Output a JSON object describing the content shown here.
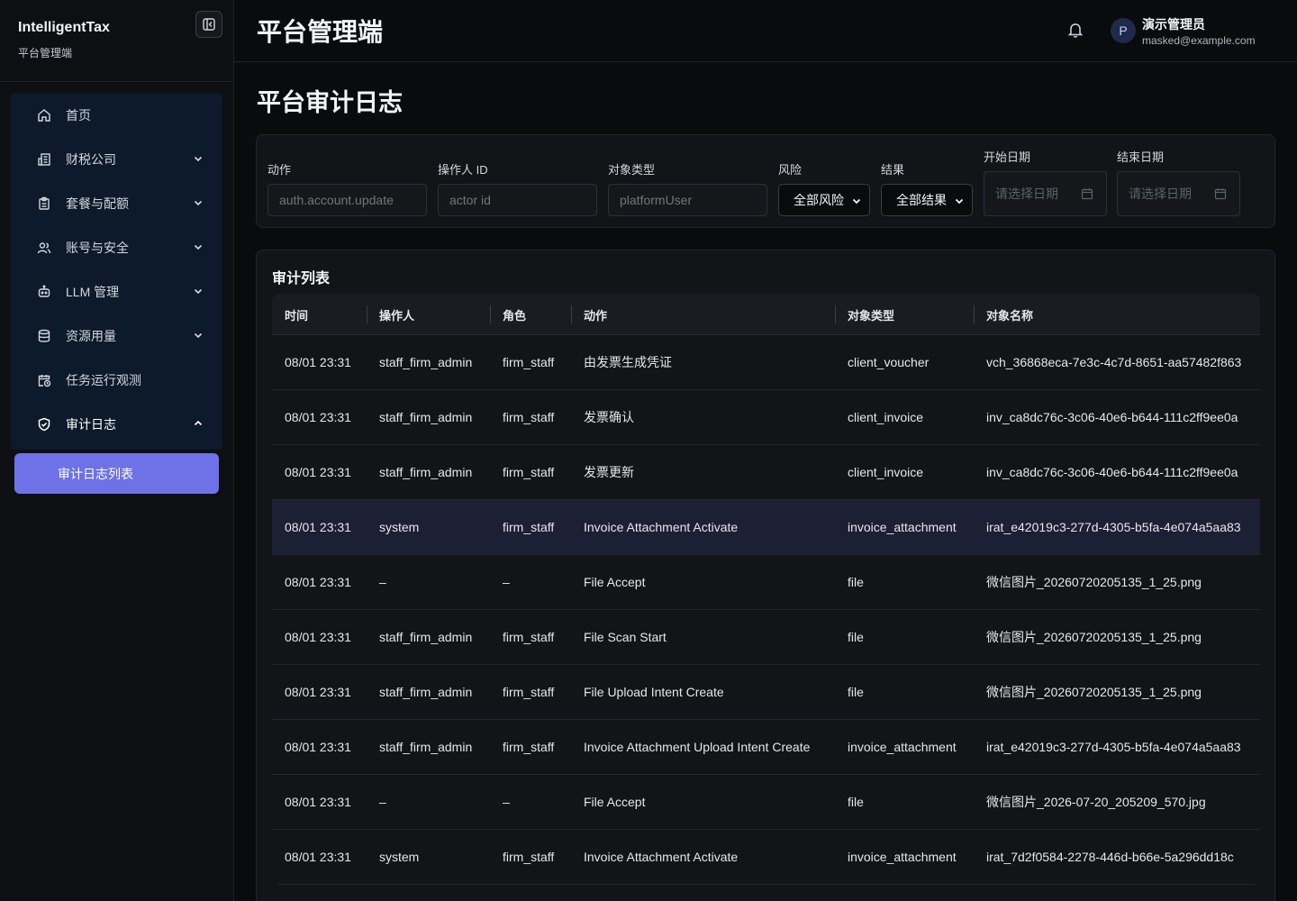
{
  "brand": {
    "name": "IntelligentTax",
    "subtitle": "平台管理端"
  },
  "nav": {
    "items": [
      {
        "label": "首页",
        "icon": "home-icon",
        "expandable": false
      },
      {
        "label": "财税公司",
        "icon": "building-icon",
        "expandable": true,
        "expanded": false
      },
      {
        "label": "套餐与配额",
        "icon": "clipboard-icon",
        "expandable": true,
        "expanded": false
      },
      {
        "label": "账号与安全",
        "icon": "users-icon",
        "expandable": true,
        "expanded": false
      },
      {
        "label": "LLM 管理",
        "icon": "robot-icon",
        "expandable": true,
        "expanded": false
      },
      {
        "label": "资源用量",
        "icon": "database-icon",
        "expandable": true,
        "expanded": false
      },
      {
        "label": "任务运行观测",
        "icon": "calendar-clock-icon",
        "expandable": false
      },
      {
        "label": "审计日志",
        "icon": "shield-check-icon",
        "expandable": true,
        "expanded": true
      }
    ],
    "active_sub": "审计日志列表"
  },
  "header": {
    "title": "平台管理端",
    "user": {
      "initial": "P",
      "name": "演示管理员",
      "email": "masked@example.com"
    }
  },
  "page": {
    "title": "平台审计日志"
  },
  "filters": {
    "action": {
      "label": "动作",
      "placeholder": "auth.account.update"
    },
    "actor": {
      "label": "操作人 ID",
      "placeholder": "actor id"
    },
    "target_type": {
      "label": "对象类型",
      "placeholder": "platformUser"
    },
    "risk": {
      "label": "风险",
      "value": "全部风险"
    },
    "result": {
      "label": "结果",
      "value": "全部结果"
    },
    "start_date": {
      "label": "开始日期",
      "placeholder": "请选择日期"
    },
    "end_date": {
      "label": "结束日期",
      "placeholder": "请选择日期"
    }
  },
  "list": {
    "title": "审计列表",
    "columns": [
      "时间",
      "操作人",
      "角色",
      "动作",
      "对象类型",
      "对象名称"
    ],
    "rows": [
      {
        "time": "08/01 23:31",
        "actor": "staff_firm_admin",
        "role": "firm_staff",
        "action": "由发票生成凭证",
        "target_type": "client_voucher",
        "target_name": "vch_36868eca-7e3c-4c7d-8651-aa57482f863"
      },
      {
        "time": "08/01 23:31",
        "actor": "staff_firm_admin",
        "role": "firm_staff",
        "action": "发票确认",
        "target_type": "client_invoice",
        "target_name": "inv_ca8dc76c-3c06-40e6-b644-111c2ff9ee0a"
      },
      {
        "time": "08/01 23:31",
        "actor": "staff_firm_admin",
        "role": "firm_staff",
        "action": "发票更新",
        "target_type": "client_invoice",
        "target_name": "inv_ca8dc76c-3c06-40e6-b644-111c2ff9ee0a"
      },
      {
        "time": "08/01 23:31",
        "actor": "system",
        "role": "firm_staff",
        "action": "Invoice Attachment Activate",
        "target_type": "invoice_attachment",
        "target_name": "irat_e42019c3-277d-4305-b5fa-4e074a5aa83"
      },
      {
        "time": "08/01 23:31",
        "actor": "–",
        "role": "–",
        "action": "File Accept",
        "target_type": "file",
        "target_name": "微信图片_20260720205135_1_25.png"
      },
      {
        "time": "08/01 23:31",
        "actor": "staff_firm_admin",
        "role": "firm_staff",
        "action": "File Scan Start",
        "target_type": "file",
        "target_name": "微信图片_20260720205135_1_25.png"
      },
      {
        "time": "08/01 23:31",
        "actor": "staff_firm_admin",
        "role": "firm_staff",
        "action": "File Upload Intent Create",
        "target_type": "file",
        "target_name": "微信图片_20260720205135_1_25.png"
      },
      {
        "time": "08/01 23:31",
        "actor": "staff_firm_admin",
        "role": "firm_staff",
        "action": "Invoice Attachment Upload Intent Create",
        "target_type": "invoice_attachment",
        "target_name": "irat_e42019c3-277d-4305-b5fa-4e074a5aa83"
      },
      {
        "time": "08/01 23:31",
        "actor": "–",
        "role": "–",
        "action": "File Accept",
        "target_type": "file",
        "target_name": "微信图片_2026-07-20_205209_570.jpg"
      },
      {
        "time": "08/01 23:31",
        "actor": "system",
        "role": "firm_staff",
        "action": "Invoice Attachment Activate",
        "target_type": "invoice_attachment",
        "target_name": "irat_7d2f0584-2278-446d-b66e-5a296dd18c"
      }
    ]
  },
  "colors": {
    "accent": "#6e72e6",
    "nav_bg": "#0c1a2b",
    "highlight_row": "#1c2035"
  }
}
